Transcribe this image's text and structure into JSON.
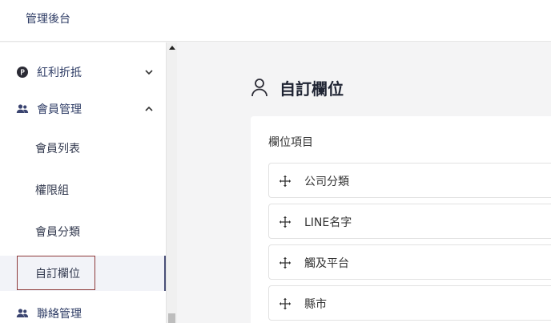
{
  "header": {
    "title": "管理後台"
  },
  "sidebar": {
    "items": [
      {
        "label": "紅利折抵",
        "icon": "points-p-icon",
        "expanded": false
      },
      {
        "label": "會員管理",
        "icon": "users-icon",
        "expanded": true
      },
      {
        "label": "聯絡管理",
        "icon": "users-icon",
        "expanded": false
      }
    ],
    "sub_items": [
      {
        "label": "會員列表"
      },
      {
        "label": "權限組"
      },
      {
        "label": "會員分類"
      },
      {
        "label": "自訂欄位",
        "active": true
      }
    ]
  },
  "main": {
    "page_title": "自訂欄位",
    "card_title": "欄位項目",
    "fields": [
      {
        "name": "公司分類"
      },
      {
        "name": "LINE名字"
      },
      {
        "name": "觸及平台"
      },
      {
        "name": "縣市"
      }
    ]
  },
  "colors": {
    "nav_text": "#2f3d66",
    "active_bg": "#f2f3f8",
    "highlight_border": "#8e3a3a"
  }
}
